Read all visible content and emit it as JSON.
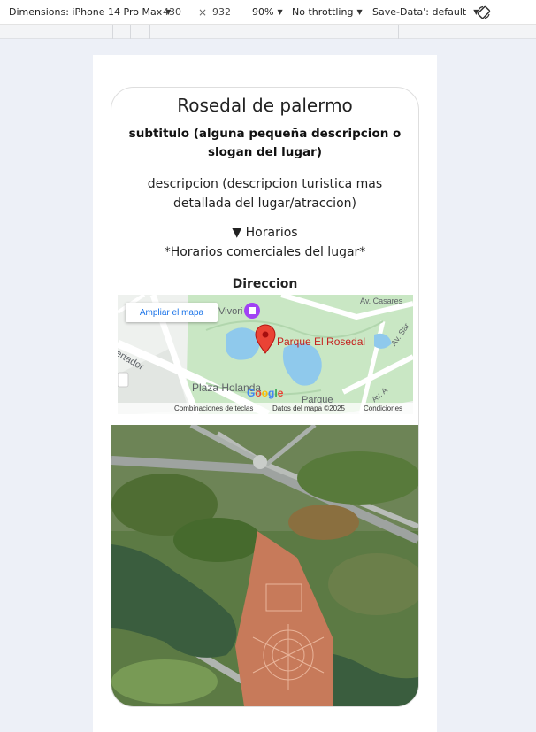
{
  "devtools": {
    "dimensions_label": "Dimensions: iPhone 14 Pro Max",
    "width": "430",
    "times": "×",
    "height": "932",
    "zoom": "90%",
    "throttling": "No throttling",
    "save_data": "'Save-Data': default"
  },
  "page": {
    "title": "Rosedal de palermo",
    "subtitle": "subtitulo (alguna pequeña descripcion o slogan del lugar)",
    "description": "descripcion (descripcion turistica mas detallada del lugar/atraccion)",
    "hours_toggle": "▼ Horarios",
    "hours_text": "*Horarios comerciales del lugar*",
    "address_label": "Direccion"
  },
  "map": {
    "expand_button": "Ampliar el mapa",
    "place_name": "Parque El Rosedal",
    "label_vivori": "Vivori",
    "label_casares": "Av. Casares",
    "label_sarmiento": "Av. Sar",
    "label_ertador": "ertador",
    "label_plaza": "Plaza Holanda",
    "label_parque": "Parque",
    "label_av": "Av. A",
    "keyboard_shortcuts": "Combinaciones de teclas",
    "map_data": "Datos del mapa ©2025",
    "terms": "Condiciones",
    "logo": "Google"
  },
  "colors": {
    "park_green": "#c9e7c4",
    "water": "#8fc9ec",
    "pin_red": "#ea4335",
    "link_blue": "#1a73e8"
  }
}
